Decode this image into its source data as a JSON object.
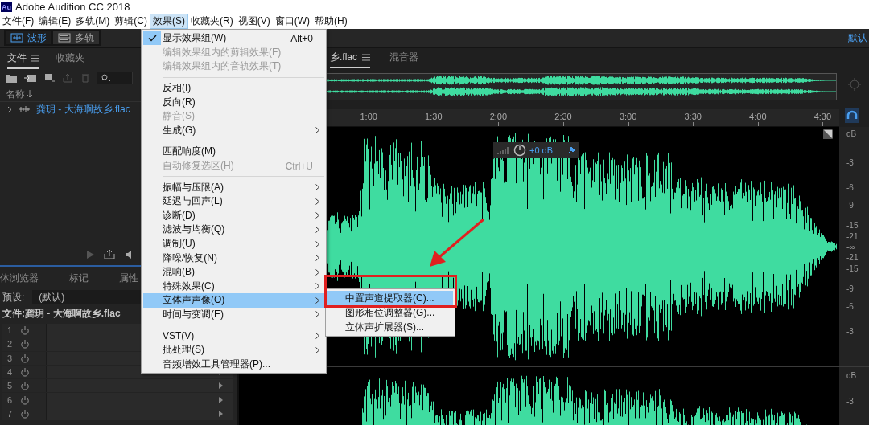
{
  "window": {
    "app_badge": "Au",
    "title": "Adobe Audition CC 2018"
  },
  "menubar": [
    {
      "label": "文件(F)",
      "selected": false
    },
    {
      "label": "编辑(E)",
      "selected": false
    },
    {
      "label": "多轨(M)",
      "selected": false
    },
    {
      "label": "剪辑(C)",
      "selected": false
    },
    {
      "label": "效果(S)",
      "selected": true
    },
    {
      "label": "收藏夹(R)",
      "selected": false
    },
    {
      "label": "视图(V)",
      "selected": false
    },
    {
      "label": "窗口(W)",
      "selected": false
    },
    {
      "label": "帮助(H)",
      "selected": false
    }
  ],
  "workspace": {
    "modes": [
      {
        "label": "波形",
        "selected": true
      },
      {
        "label": "多轨",
        "selected": false
      }
    ],
    "workspace_name": "默认"
  },
  "files_panel": {
    "tabs": [
      {
        "label": "文件",
        "selected": true
      },
      {
        "label": "收藏夹",
        "selected": false
      }
    ],
    "column_header": "名称",
    "files": [
      {
        "name": "龚玥 - 大海啊故乡.flac",
        "expanded": false
      }
    ]
  },
  "effects_rack": {
    "tabs": [
      {
        "label": "体浏览器",
        "selected": false
      },
      {
        "label": "标记",
        "selected": false
      },
      {
        "label": "属性",
        "selected": false
      }
    ],
    "preset_label": "预设:",
    "preset_value": "(默认)",
    "file_label": "文件:龚玥 - 大海啊故乡.flac",
    "slots": [
      {
        "number": "1"
      },
      {
        "number": "2"
      },
      {
        "number": "3"
      },
      {
        "number": "4"
      },
      {
        "number": "5"
      },
      {
        "number": "6"
      },
      {
        "number": "7"
      }
    ]
  },
  "editor": {
    "tabs": [
      {
        "label": "乡.flac",
        "selected": true
      },
      {
        "label": "混音器",
        "selected": false
      }
    ],
    "ruler": [
      "1:00",
      "1:30",
      "2:00",
      "2:30",
      "3:00",
      "3:30",
      "4:00",
      "4:30"
    ],
    "hud": {
      "reading": "+0 dB"
    },
    "db_scale": {
      "channel_1": [
        "dB",
        "-3",
        "-6",
        "-9",
        "-15",
        "-21",
        "-∞",
        "-21",
        "-15",
        "-9",
        "-6",
        "-3"
      ],
      "channel_2": [
        "dB",
        "-3"
      ]
    }
  },
  "effects_menu": {
    "items": [
      {
        "kind": "item",
        "label": "显示效果组(W)",
        "shortcut": "Alt+0",
        "checked": true,
        "disabled": false,
        "submenu": false,
        "selected": false
      },
      {
        "kind": "item",
        "label": "编辑效果组内的剪辑效果(F)",
        "checked": false,
        "disabled": true,
        "submenu": false,
        "selected": false
      },
      {
        "kind": "item",
        "label": "编辑效果组内的音轨效果(T)",
        "checked": false,
        "disabled": true,
        "submenu": false,
        "selected": false
      },
      {
        "kind": "separator"
      },
      {
        "kind": "item",
        "label": "反相(I)",
        "checked": false,
        "disabled": false,
        "submenu": false,
        "selected": false
      },
      {
        "kind": "item",
        "label": "反向(R)",
        "checked": false,
        "disabled": false,
        "submenu": false,
        "selected": false
      },
      {
        "kind": "item",
        "label": "静音(S)",
        "checked": false,
        "disabled": true,
        "submenu": false,
        "selected": false
      },
      {
        "kind": "item",
        "label": "生成(G)",
        "checked": false,
        "disabled": false,
        "submenu": true,
        "selected": false
      },
      {
        "kind": "separator"
      },
      {
        "kind": "item",
        "label": "匹配响度(M)",
        "checked": false,
        "disabled": false,
        "submenu": false,
        "selected": false
      },
      {
        "kind": "item",
        "label": "自动修复选区(H)",
        "shortcut": "Ctrl+U",
        "checked": false,
        "disabled": true,
        "submenu": false,
        "selected": false
      },
      {
        "kind": "separator"
      },
      {
        "kind": "item",
        "label": "振幅与压限(A)",
        "checked": false,
        "disabled": false,
        "submenu": true,
        "selected": false
      },
      {
        "kind": "item",
        "label": "延迟与回声(L)",
        "checked": false,
        "disabled": false,
        "submenu": true,
        "selected": false
      },
      {
        "kind": "item",
        "label": "诊断(D)",
        "checked": false,
        "disabled": false,
        "submenu": true,
        "selected": false
      },
      {
        "kind": "item",
        "label": "滤波与均衡(Q)",
        "checked": false,
        "disabled": false,
        "submenu": true,
        "selected": false
      },
      {
        "kind": "item",
        "label": "调制(U)",
        "checked": false,
        "disabled": false,
        "submenu": true,
        "selected": false
      },
      {
        "kind": "item",
        "label": "降噪/恢复(N)",
        "checked": false,
        "disabled": false,
        "submenu": true,
        "selected": false
      },
      {
        "kind": "item",
        "label": "混响(B)",
        "checked": false,
        "disabled": false,
        "submenu": true,
        "selected": false
      },
      {
        "kind": "item",
        "label": "特殊效果(C)",
        "checked": false,
        "disabled": false,
        "submenu": true,
        "selected": false
      },
      {
        "kind": "item",
        "label": "立体声声像(O)",
        "checked": false,
        "disabled": false,
        "submenu": true,
        "selected": true
      },
      {
        "kind": "item",
        "label": "时间与变调(E)",
        "checked": false,
        "disabled": false,
        "submenu": true,
        "selected": false
      },
      {
        "kind": "separator"
      },
      {
        "kind": "item",
        "label": "VST(V)",
        "checked": false,
        "disabled": false,
        "submenu": true,
        "selected": false
      },
      {
        "kind": "item",
        "label": "批处理(S)",
        "checked": false,
        "disabled": false,
        "submenu": true,
        "selected": false
      },
      {
        "kind": "item",
        "label": "音频增效工具管理器(P)...",
        "checked": false,
        "disabled": false,
        "submenu": false,
        "selected": false
      }
    ]
  },
  "submenu": {
    "items": [
      {
        "label": "中置声道提取器(C)...",
        "selected": true
      },
      {
        "label": "图形相位调整器(G)...",
        "selected": false
      },
      {
        "label": "立体声扩展器(S)...",
        "selected": false
      }
    ]
  },
  "highlight_box": {
    "color": "#e02020"
  },
  "arrow": {
    "color": "#e02020"
  }
}
